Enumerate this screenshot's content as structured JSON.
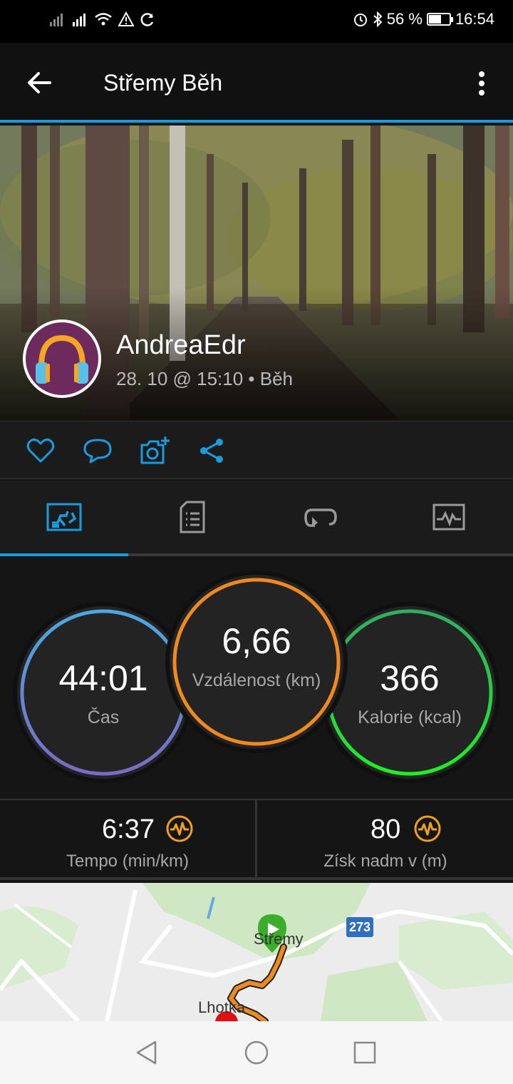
{
  "status_bar": {
    "battery_percent": "56 %",
    "battery_level": 0.56,
    "time": "16:54",
    "icons": [
      "signal-icon",
      "signal-icon",
      "wifi-icon",
      "warning-icon",
      "sync-icon",
      "alarm-icon",
      "bluetooth-icon",
      "battery-icon"
    ]
  },
  "app_bar": {
    "title": "Střemy Běh"
  },
  "activity": {
    "username": "AndreaEdr",
    "subline": "28. 10 @ 15:10 • Běh"
  },
  "actions": [
    "like-icon",
    "comment-icon",
    "add-photo-icon",
    "share-icon"
  ],
  "tabs": {
    "active_index": 0,
    "items": [
      "overview-icon",
      "details-icon",
      "laps-icon",
      "charts-icon"
    ]
  },
  "stats": {
    "time": {
      "value": "44:01",
      "label": "Čas"
    },
    "distance": {
      "value": "6,66",
      "label": "Vzdálenost (km)"
    },
    "calories": {
      "value": "366",
      "label": "Kalorie (kcal)"
    }
  },
  "metrics": {
    "pace": {
      "value": "6:37",
      "label": "Tempo (min/km)"
    },
    "elevation": {
      "value": "80",
      "label": "Získ nadm v (m)"
    }
  },
  "map": {
    "labels": {
      "town1": "Střemy",
      "town2": "Lhotka",
      "road": "273"
    }
  },
  "colors": {
    "accent": "#1a9be0",
    "time_ring": "#5aa0dc",
    "distance_ring": "#f08a1e",
    "calories_ring": "#2fcf3e",
    "metric_icon": "#f0a020"
  }
}
